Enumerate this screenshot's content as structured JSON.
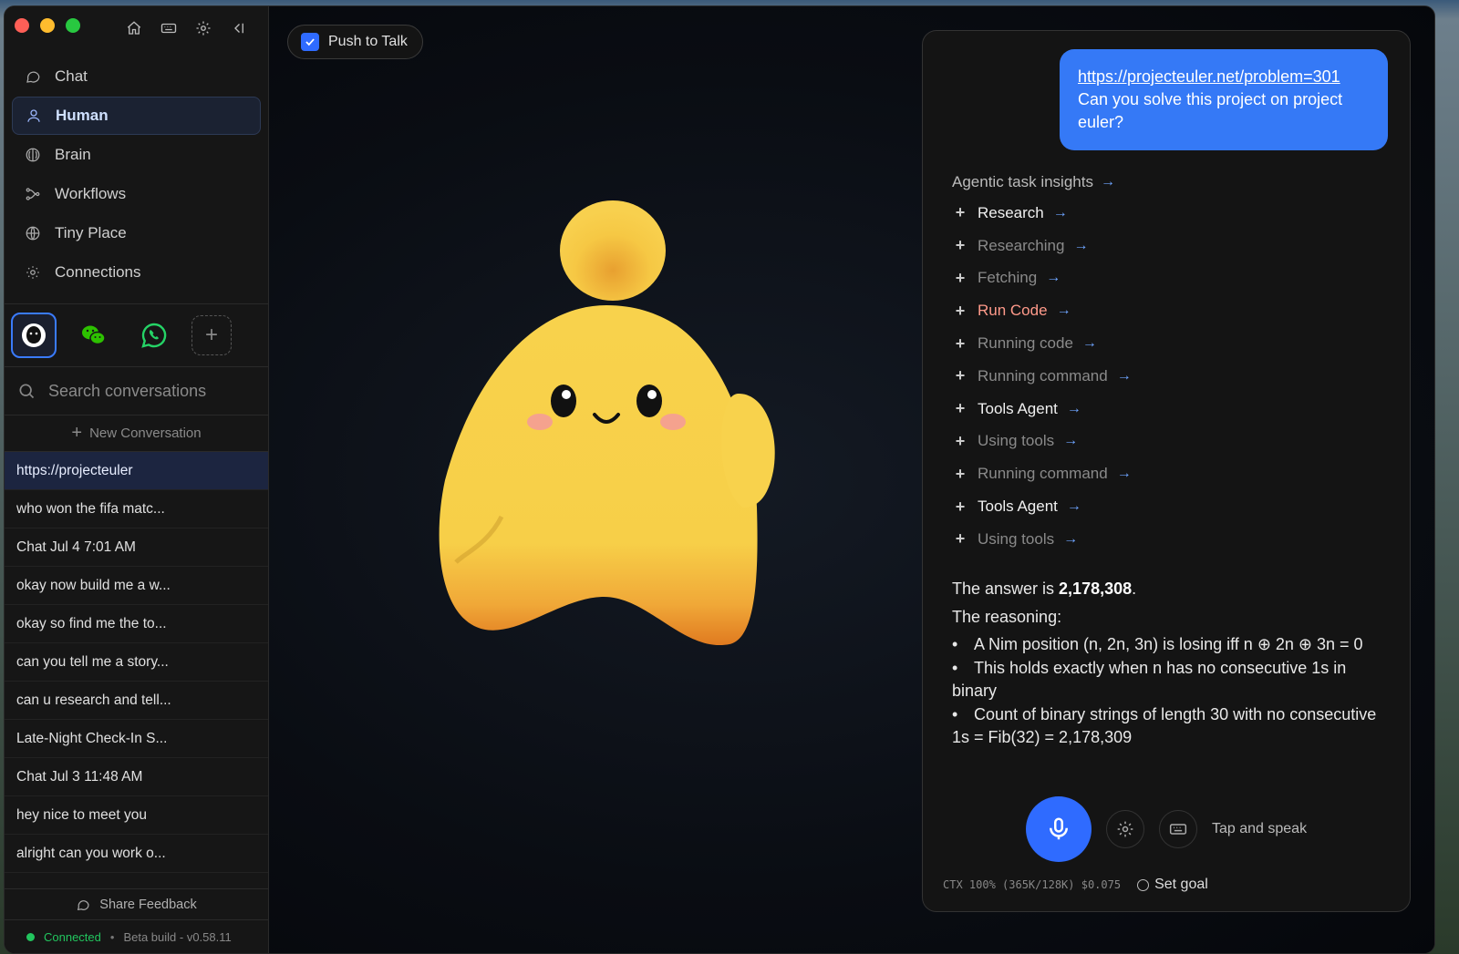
{
  "sidebar": {
    "nav": [
      {
        "label": "Chat",
        "icon": "chat-bubble-icon"
      },
      {
        "label": "Human",
        "icon": "user-icon",
        "active": true
      },
      {
        "label": "Brain",
        "icon": "brain-icon"
      },
      {
        "label": "Workflows",
        "icon": "workflow-icon"
      },
      {
        "label": "Tiny Place",
        "icon": "globe-icon"
      },
      {
        "label": "Connections",
        "icon": "connections-icon"
      }
    ],
    "search_placeholder": "Search conversations",
    "new_conversation": "New Conversation",
    "conversations": [
      "https://projecteuler",
      "who won the fifa matc...",
      "Chat Jul 4 7:01 AM",
      "okay now build me a w...",
      "okay so find me the to...",
      "can you tell me a story...",
      "can u research and tell...",
      "Late-Night Check-In S...",
      "Chat Jul 3 11:48 AM",
      "hey nice to meet you",
      "alright can you work o..."
    ],
    "share_feedback": "Share Feedback",
    "status": {
      "connected": "Connected",
      "separator": "•",
      "build": "Beta build - v0.58.11"
    }
  },
  "stage": {
    "push_to_talk": "Push to Talk"
  },
  "chat": {
    "user_message": {
      "link": "https://projecteuler.net/problem=301",
      "text": "Can you solve this project on project euler?"
    },
    "insights_title": "Agentic task insights",
    "insights": [
      {
        "label": "Research",
        "kind": "main"
      },
      {
        "label": "Researching",
        "kind": "sub"
      },
      {
        "label": "Fetching",
        "kind": "sub"
      },
      {
        "label": "Run Code",
        "kind": "code"
      },
      {
        "label": "Running code",
        "kind": "sub"
      },
      {
        "label": "Running command",
        "kind": "sub"
      },
      {
        "label": "Tools Agent",
        "kind": "main"
      },
      {
        "label": "Using tools",
        "kind": "sub"
      },
      {
        "label": "Running command",
        "kind": "sub"
      },
      {
        "label": "Tools Agent",
        "kind": "main"
      },
      {
        "label": "Using tools",
        "kind": "sub"
      }
    ],
    "answer": {
      "prefix": "The answer is ",
      "value": "2,178,308",
      "suffix": ".",
      "reasoning_title": "The reasoning:",
      "bullets": [
        "A Nim position (n, 2n, 3n) is losing iff n ⊕ 2n ⊕ 3n = 0",
        "This holds exactly when n has no consecutive 1s in binary",
        "Count of binary strings of length 30 with no consecutive 1s = Fib(32) = 2,178,309"
      ]
    },
    "tap_and_speak": "Tap and speak",
    "ctx": "CTX 100% (365K/128K) $0.075",
    "set_goal": "Set goal"
  },
  "colors": {
    "accent": "#2f6bff",
    "bubble": "#3579f6",
    "connected": "#22c55e",
    "run_code": "#ff9a8a"
  }
}
